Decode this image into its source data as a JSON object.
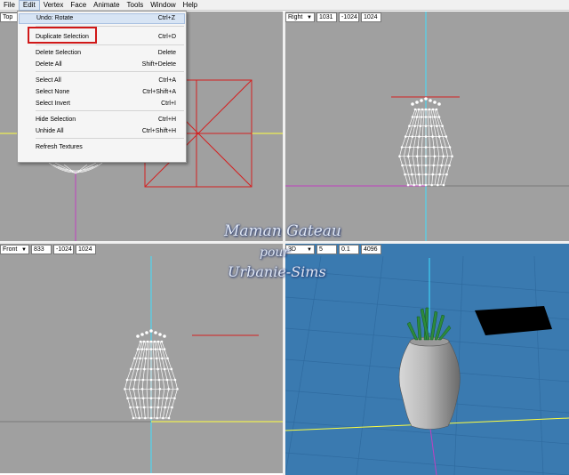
{
  "menubar": {
    "items": [
      "File",
      "Edit",
      "Vertex",
      "Face",
      "Animate",
      "Tools",
      "Window",
      "Help"
    ],
    "active": "Edit"
  },
  "edit_menu": {
    "items": [
      {
        "label": "Undo: Rotate",
        "shortcut": "Ctrl+Z",
        "highlighted": true
      },
      {
        "label": "Duplicate Selection",
        "shortcut": "Ctrl+D",
        "annotated": true
      },
      {
        "label": "Delete Selection",
        "shortcut": "Delete"
      },
      {
        "label": "Delete All",
        "shortcut": "Shift+Delete"
      },
      {
        "label": "Select All",
        "shortcut": "Ctrl+A"
      },
      {
        "label": "Select None",
        "shortcut": "Ctrl+Shift+A"
      },
      {
        "label": "Select Invert",
        "shortcut": "Ctrl+I"
      },
      {
        "label": "Hide Selection",
        "shortcut": "Ctrl+H"
      },
      {
        "label": "Unhide All",
        "shortcut": "Ctrl+Shift+H"
      },
      {
        "label": "Refresh Textures",
        "shortcut": ""
      }
    ],
    "annotation_color": "#d01818"
  },
  "viewports": {
    "top": {
      "view": "Top"
    },
    "right": {
      "view": "Right",
      "fields": [
        "1031",
        "-1024",
        "1024"
      ]
    },
    "front": {
      "view": "Front",
      "fields": [
        "833",
        "-1024",
        "1024"
      ]
    },
    "persp": {
      "view": "3D",
      "fields": [
        "5",
        "0.1",
        "4096"
      ]
    }
  },
  "watermark": {
    "line1": "Maman Gateau",
    "line2": "pour",
    "line3": "Urbanie-Sims"
  },
  "colors": {
    "viewport_bg": "#a0a0a0",
    "perspective_bg": "#3a7ab0",
    "axis_x": "#ffff40",
    "axis_y": "#40e0ff",
    "axis_z": "#c040c0",
    "selection": "#d42020"
  }
}
